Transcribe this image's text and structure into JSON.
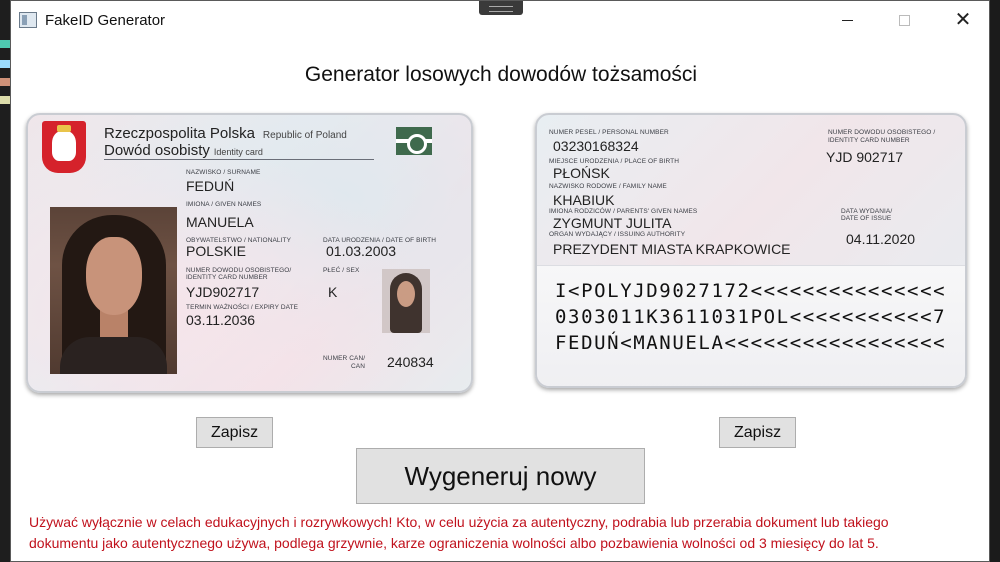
{
  "window": {
    "title": "FakeID Generator",
    "minimize_label": "–",
    "maximize_label": "☐",
    "close_label": "✕"
  },
  "heading": "Generator losowych dowodów tożsamości",
  "front": {
    "country": "Rzeczpospolita Polska",
    "country_en": "Republic of Poland",
    "doc_type": "Dowód osobisty",
    "doc_type_en": "Identity card",
    "surname_label": "Nazwisko / Surname",
    "surname": "FEDUŃ",
    "given_label": "Imiona / Given names",
    "given": "MANUELA",
    "nationality_label": "Obywatelstwo / Nationality",
    "nationality": "POLSKIE",
    "dob_label": "Data urodzenia / Date of birth",
    "dob": "01.03.2003",
    "docnum_label_1": "Numer dowodu osobistego/",
    "docnum_label_2": "Identity card number",
    "docnum": "YJD902717",
    "sex_label": "Płeć / Sex",
    "sex": "K",
    "expiry_label": "Termin ważności / Expiry date",
    "expiry": "03.11.2036",
    "can_label_1": "Numer CAN/",
    "can_label_2": "CAN",
    "can": "240834"
  },
  "back": {
    "pesel_label": "Numer PESEL / Personal number",
    "pesel": "03230168324",
    "docnum_label_1": "Numer dowodu osobistego /",
    "docnum_label_2": "Identity card number",
    "docnum": "YJD 902717",
    "pob_label": "Miejsce urodzenia / Place of birth",
    "pob": "PŁOŃSK",
    "family_label": "Nazwisko rodowe / Family name",
    "family": "KHABIUK",
    "parents_label": "Imiona rodziców / Parents' given names",
    "parents": "ZYGMUNT JULITA",
    "issue_label_1": "Data wydania/",
    "issue_label_2": "Date of issue",
    "issue": "04.11.2020",
    "authority_label": "Organ wydający / Issuing authority",
    "authority": "PREZYDENT MIASTA KRAPKOWICE",
    "mrz": [
      "I<POLYJD9027172<<<<<<<<<<<<<<<",
      "0303011K3611031POL<<<<<<<<<<<7",
      "FEDUŃ<MANUELA<<<<<<<<<<<<<<<<<"
    ]
  },
  "buttons": {
    "save_front": "Zapisz",
    "save_back": "Zapisz",
    "generate": "Wygeneruj nowy"
  },
  "warning": {
    "line1": "Używać wyłącznie w celach edukacyjnych i rozrywkowych! Kto, w celu użycia za autentyczny, podrabia lub przerabia dokument lub takiego",
    "line2": "dokumentu jako autentycznego używa, podlega grzywnie, karze ograniczenia wolności albo pozbawienia wolności od 3 miesięcy do lat 5."
  },
  "colors": {
    "warning_text": "#c0111c",
    "button_bg": "#e1e1e1",
    "button_border": "#adadad"
  }
}
